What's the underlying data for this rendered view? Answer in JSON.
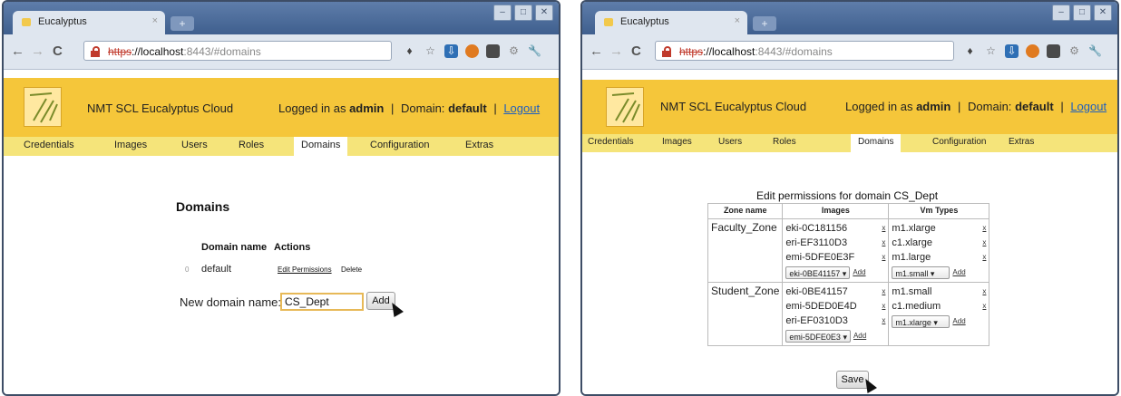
{
  "windows": [
    {
      "tab_title": "Eucalyptus",
      "tab_close": "×",
      "url": {
        "scheme": "https",
        "host": "://localhost",
        "rest": ":8443/#domains"
      },
      "header": {
        "app_title": "NMT SCL Eucalyptus Cloud",
        "logged_in_prefix": "Logged in as",
        "user": "admin",
        "separator": "|",
        "domain_prefix": "Domain:",
        "domain": "default",
        "logout": "Logout"
      },
      "nav_tabs": [
        "Credentials",
        "Images",
        "Users",
        "Roles",
        "Domains",
        "Configuration",
        "Extras"
      ],
      "active_tab": "Domains",
      "page": {
        "title": "Domains",
        "columns": [
          "Domain name",
          "Actions"
        ],
        "rows": [
          {
            "index": "0",
            "name": "default",
            "edit": "Edit Permissions",
            "delete": "Delete"
          }
        ],
        "new_domain_label": "New domain name:",
        "new_domain_value": "CS_Dept",
        "add_button": "Add"
      }
    },
    {
      "tab_title": "Eucalyptus",
      "tab_close": "×",
      "url": {
        "scheme": "https",
        "host": "://localhost",
        "rest": ":8443/#domains"
      },
      "header": {
        "app_title": "NMT SCL Eucalyptus Cloud",
        "logged_in_prefix": "Logged in as",
        "user": "admin",
        "separator": "|",
        "domain_prefix": "Domain:",
        "domain": "default",
        "logout": "Logout"
      },
      "nav_tabs": [
        "Credentials",
        "Images",
        "Users",
        "Roles",
        "Domains",
        "Configuration",
        "Extras"
      ],
      "active_tab": "Domains",
      "permissions": {
        "title": "Edit permissions for domain CS_Dept",
        "columns": [
          "Zone name",
          "Images",
          "Vm Types"
        ],
        "remove_label": "x",
        "add_label": "Add",
        "zones": [
          {
            "name": "Faculty_Zone",
            "images": [
              "eki-0C181156",
              "eri-EF3110D3",
              "emi-5DFE0E3F"
            ],
            "image_select": "eki-0BE41157",
            "vmtypes": [
              "m1.xlarge",
              "c1.xlarge",
              "m1.large"
            ],
            "vm_select": "m1.small"
          },
          {
            "name": "Student_Zone",
            "images": [
              "eki-0BE41157",
              "emi-5DED0E4D",
              "eri-EF0310D3"
            ],
            "image_select": "emi-5DFE0E3",
            "vmtypes": [
              "m1.small",
              "c1.medium"
            ],
            "vm_select": "m1.xlarge"
          }
        ],
        "save_button": "Save"
      }
    }
  ],
  "colors": {
    "titlebar": "#4a6a98",
    "header_bg": "#f5c63a",
    "nav_bg": "#f5e47a",
    "logout_link": "#1f5fbf",
    "field_border": "#e7b957"
  },
  "icons": [
    "favicon",
    "back-arrow-icon",
    "forward-arrow-icon",
    "reload-icon",
    "lock-icon",
    "bulb-icon",
    "star-icon",
    "download-icon",
    "fruit-icon",
    "page-icon",
    "gear-icon",
    "wrench-icon",
    "eucalyptus-logo",
    "mouse-cursor"
  ]
}
